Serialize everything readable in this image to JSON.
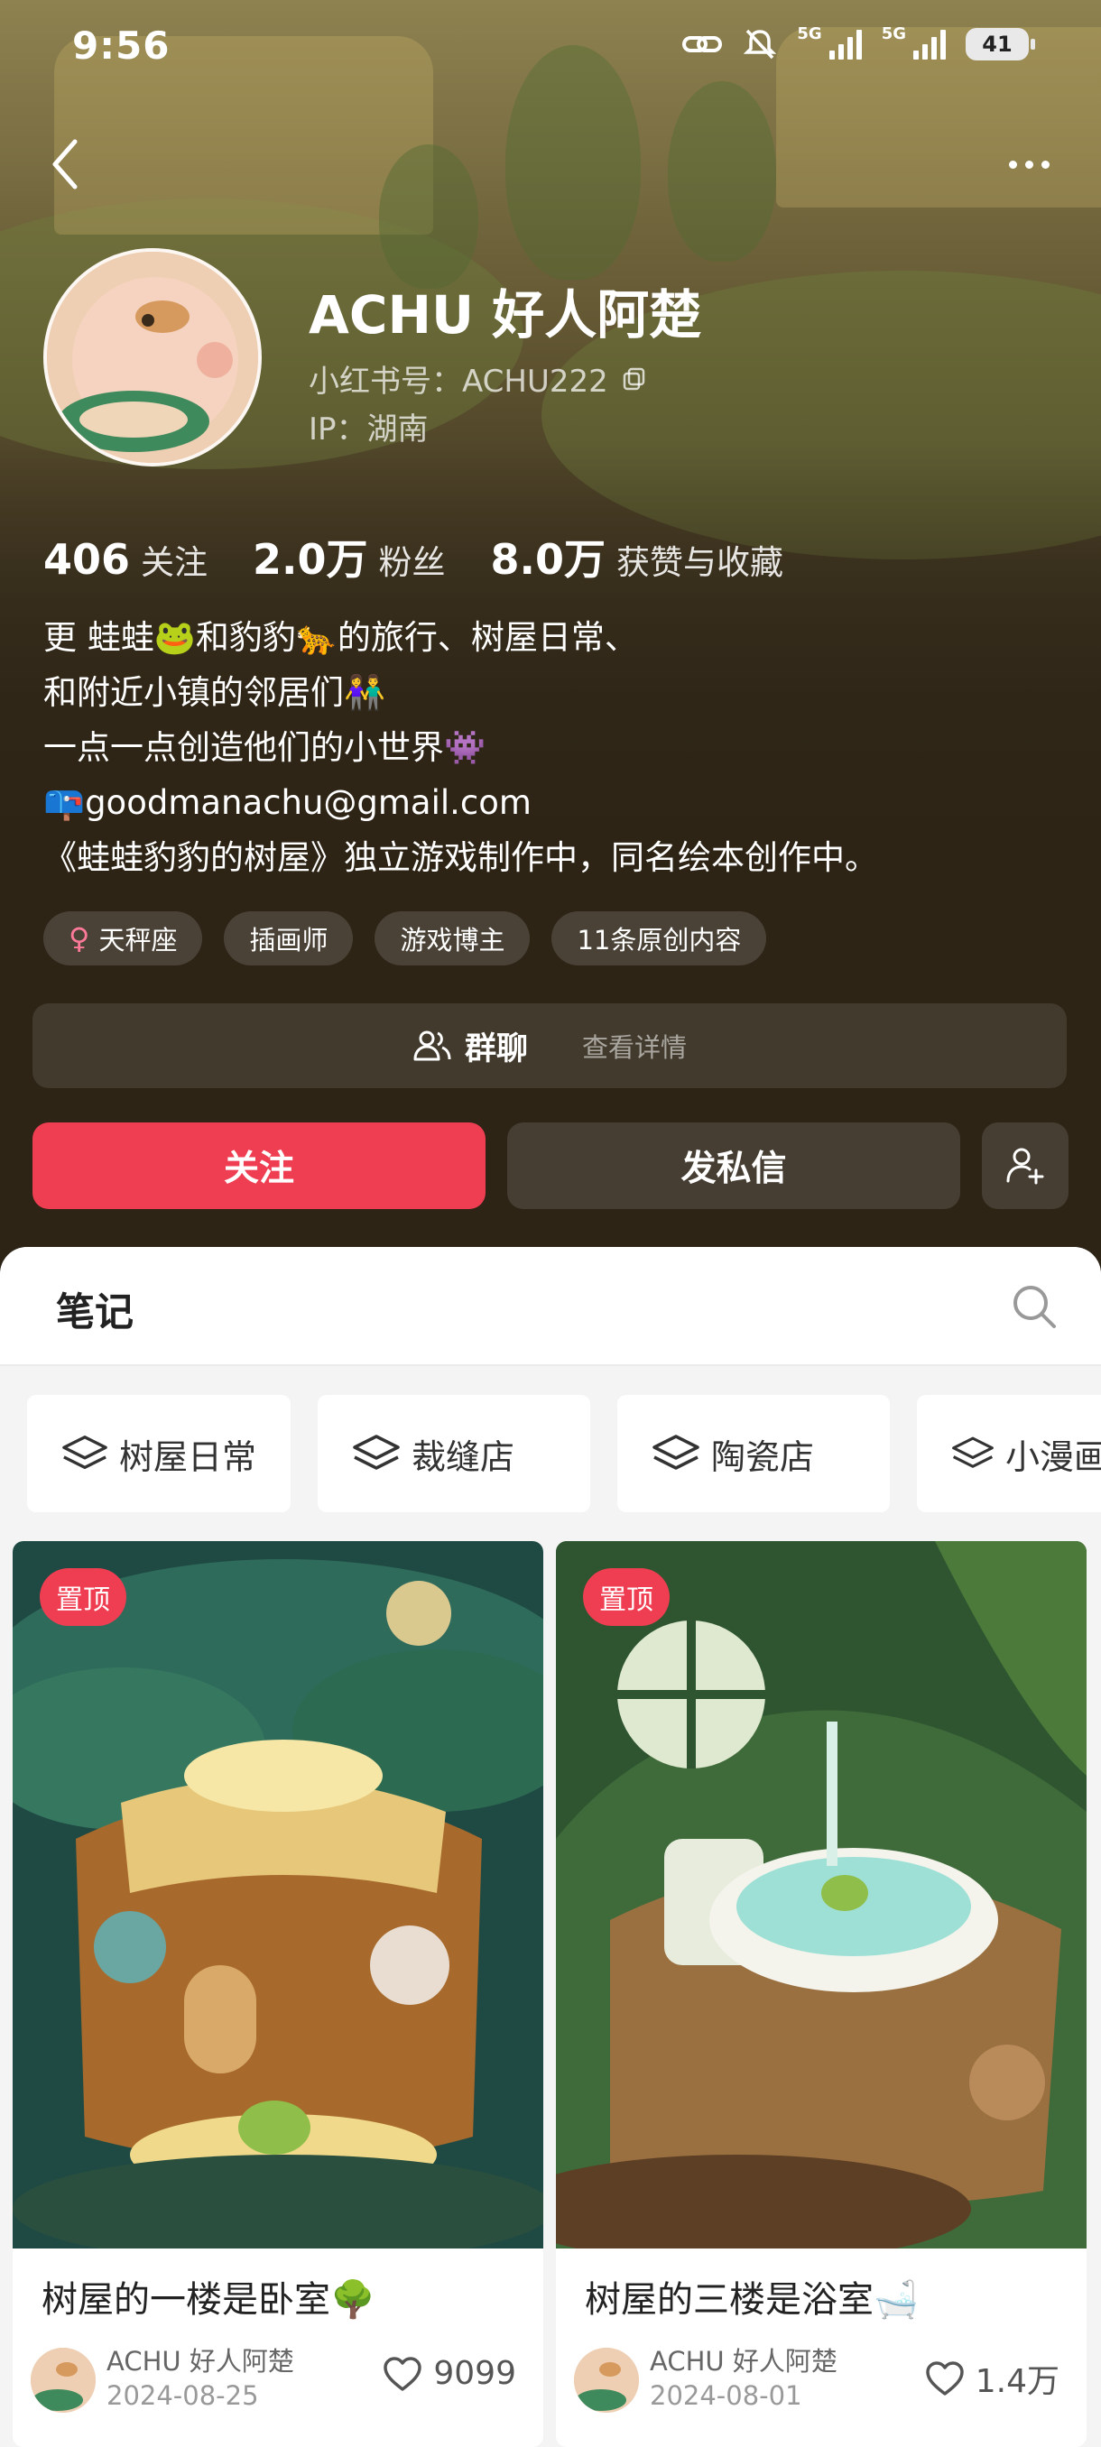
{
  "status_bar": {
    "time": "9:56",
    "network_1": "5G",
    "network_2": "5G",
    "battery": "41"
  },
  "profile": {
    "name": "ACHU 好人阿楚",
    "red_id": "小红书号：ACHU222",
    "ip": "IP：湖南",
    "stats": [
      {
        "num": "406",
        "label": "关注"
      },
      {
        "num": "2.0万",
        "label": "粉丝"
      },
      {
        "num": "8.0万",
        "label": "获赞与收藏"
      }
    ],
    "bio": [
      "更 蛙蛙🐸和豹豹🐆的旅行、树屋日常、",
      "和附近小镇的邻居们👫",
      "一点一点创造他们的小世界👾",
      "📪goodmanachu@gmail.com",
      "《蛙蛙豹豹的树屋》独立游戏制作中，同名绘本创作中。"
    ],
    "tags": [
      "天秤座",
      "插画师",
      "游戏博主",
      "11条原创内容"
    ],
    "group_chat": {
      "title": "群聊",
      "detail": "查看详情"
    },
    "follow_label": "关注",
    "message_label": "发私信"
  },
  "notes": {
    "tab_label": "笔记",
    "albums": [
      "树屋日常",
      "裁缝店",
      "陶瓷店",
      "小漫画"
    ],
    "cards": [
      {
        "pinned": "置顶",
        "title": "树屋的一楼是卧室🌳",
        "author": "ACHU 好人阿楚",
        "date": "2024-08-25",
        "likes": "9099"
      },
      {
        "pinned": "置顶",
        "title": "树屋的三楼是浴室🛁",
        "author": "ACHU 好人阿楚",
        "date": "2024-08-01",
        "likes": "1.4万"
      }
    ]
  },
  "colors": {
    "accent": "#ef3e52",
    "header_bg": "#2e2518"
  }
}
